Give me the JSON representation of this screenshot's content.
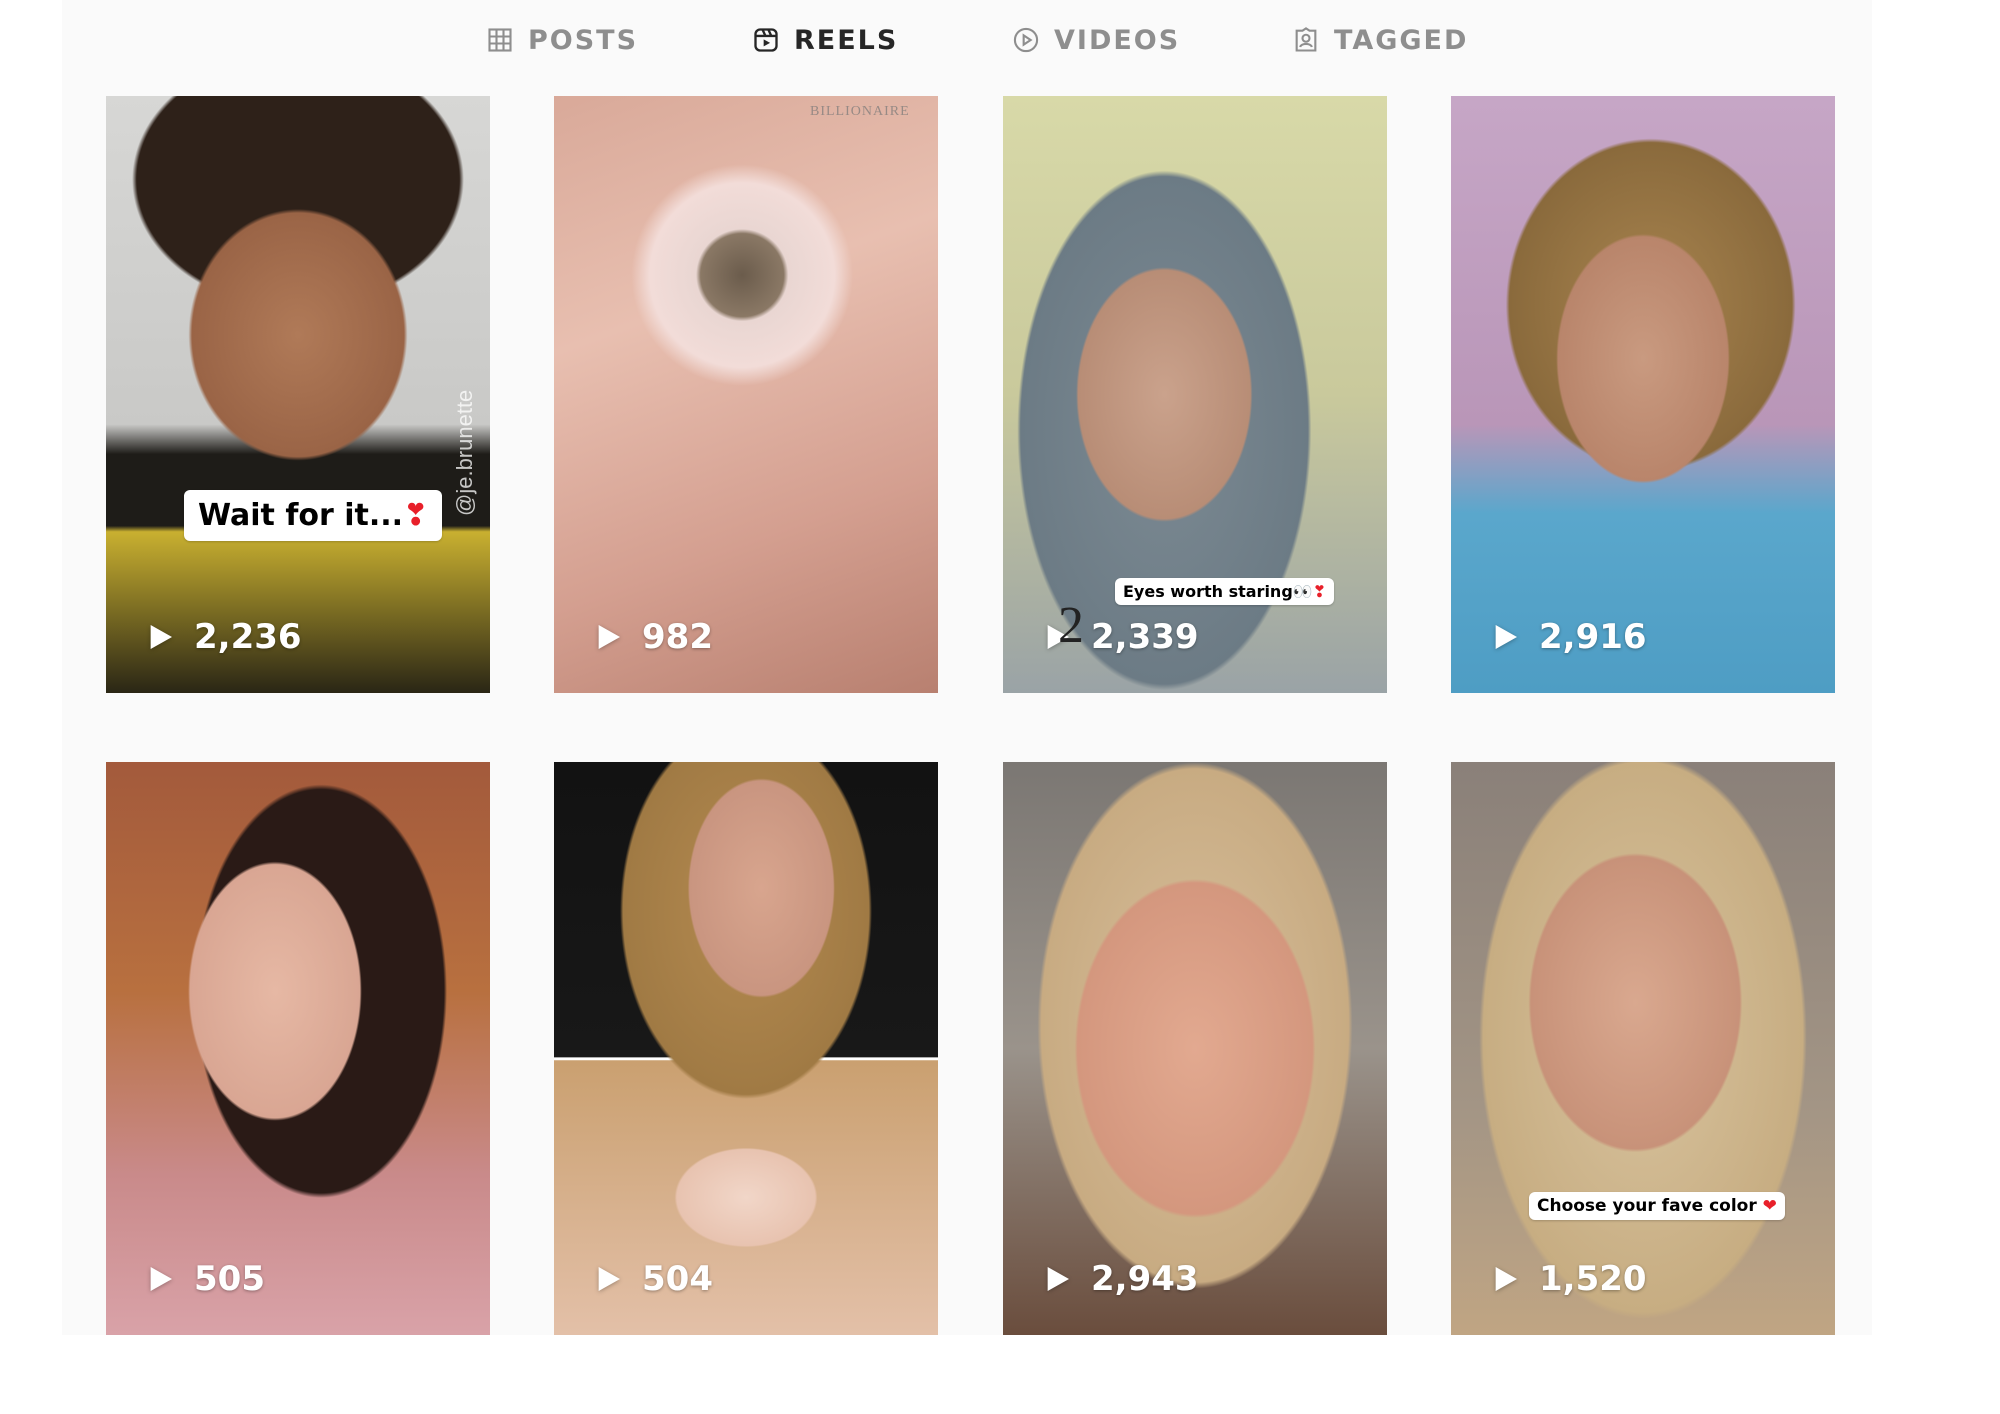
{
  "tabs": [
    {
      "label": "POSTS",
      "icon": "grid-icon",
      "active": false
    },
    {
      "label": "REELS",
      "icon": "reels-icon",
      "active": true
    },
    {
      "label": "VIDEOS",
      "icon": "play-circle-icon",
      "active": false
    },
    {
      "label": "TAGGED",
      "icon": "tagged-icon",
      "active": false
    }
  ],
  "colors": {
    "active_tab": "#262626",
    "inactive_tab": "#8e8e8e",
    "panel_background": "#fafafa",
    "caption_heart": "#e8202a"
  },
  "reels": [
    {
      "views": "2,236",
      "caption": "Wait for it...",
      "caption_emoji": "❣",
      "watermark": "@je.brunette"
    },
    {
      "views": "982",
      "watermark": "BILLIONAIRE"
    },
    {
      "views": "2,339",
      "caption": "Eyes worth staring",
      "caption_emoji": "👀❣"
    },
    {
      "views": "2,916"
    },
    {
      "views": "505"
    },
    {
      "views": "504"
    },
    {
      "views": "2,943"
    },
    {
      "views": "1,520",
      "caption": "Choose your fave color",
      "caption_emoji": "❤"
    }
  ],
  "overlay_mark": "2"
}
